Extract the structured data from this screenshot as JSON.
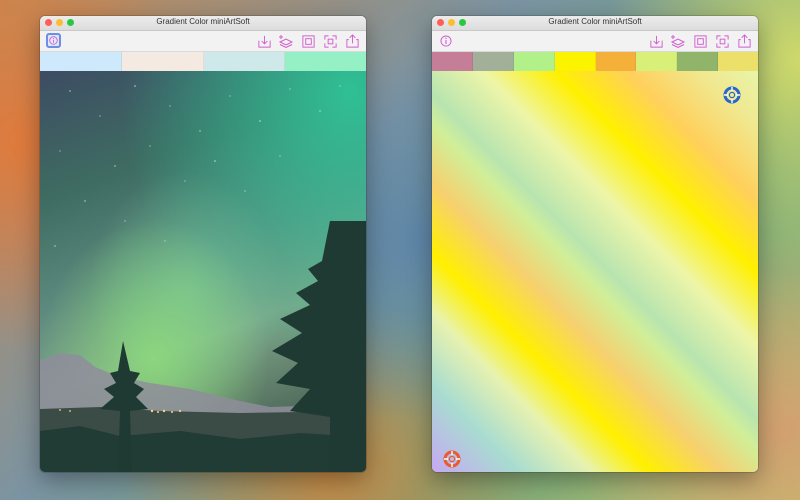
{
  "windows": [
    {
      "title": "Gradient Color miniArtSoft",
      "swatches": [
        "#cde9fb",
        "#f4eae2",
        "#cfe9ea",
        "#96f0c6"
      ]
    },
    {
      "title": "Gradient Color miniArtSoft",
      "swatches": [
        "#c47e98",
        "#a2b09a",
        "#b2f08a",
        "#fcf300",
        "#f5b03a",
        "#d8f078",
        "#90b46a",
        "#ece06a"
      ]
    }
  ],
  "colors": {
    "accent": "#d05cd0",
    "start_handle": "#ea5a2c",
    "end_handle": "#2a68c8"
  },
  "icons": [
    "info-icon",
    "import-icon",
    "add-layers-icon",
    "crop-icon",
    "fit-icon",
    "share-icon"
  ]
}
